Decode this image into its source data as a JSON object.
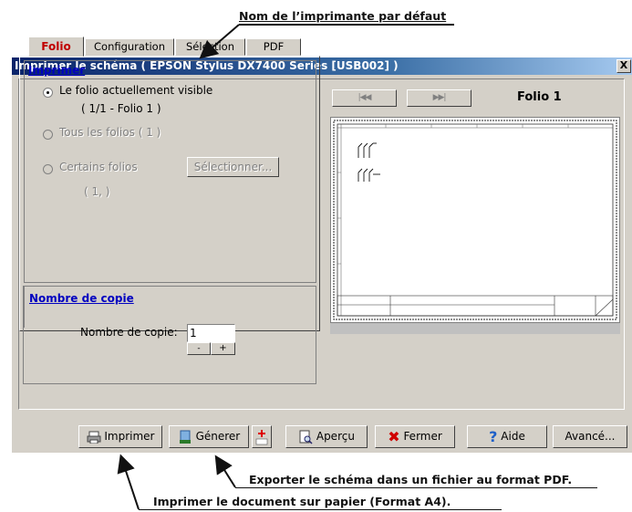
{
  "annotations": {
    "top": "Nom de l’imprimante par défaut",
    "export": "Exporter le schéma dans un fichier au format PDF.",
    "print": "Imprimer le document sur papier (Format A4)."
  },
  "dialog": {
    "title": "Imprimer le schéma ( EPSON Stylus DX7400 Series [USB002] )",
    "close": "X"
  },
  "tabs": [
    {
      "label": "Folio",
      "active": true
    },
    {
      "label": "Configuration",
      "active": false
    },
    {
      "label": "Sélection",
      "active": false
    },
    {
      "label": "PDF",
      "active": false
    }
  ],
  "imprimer": {
    "title": "Imprimer",
    "options": [
      {
        "label": "Le folio actuellement visible",
        "checked": true,
        "enabled": true
      },
      {
        "label": "Tous les folios ( 1 )",
        "checked": false,
        "enabled": false
      },
      {
        "label": "Certains folios",
        "checked": false,
        "enabled": false
      }
    ],
    "current_info": "( 1/1 - Folio 1 )",
    "some_info": "( 1, )",
    "select_button": "Sélectionner..."
  },
  "copies": {
    "title": "Nombre de copie",
    "label": "Nombre de copie:",
    "value": "1",
    "minus": "-",
    "plus": "+"
  },
  "preview": {
    "first": "|◀◀",
    "last": "▶▶|",
    "folio_label": "Folio 1"
  },
  "footer": {
    "print": "Imprimer",
    "generate": "Génerer",
    "preview": "Aperçu",
    "close": "Fermer",
    "help": "Aide",
    "advanced": "Avancé..."
  }
}
